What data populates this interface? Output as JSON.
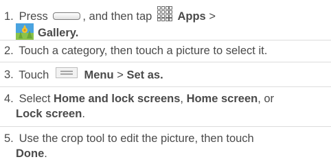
{
  "steps": [
    {
      "number": "1.",
      "press": "Press",
      "after_home": ", and then tap",
      "apps": "Apps",
      "gt": ">",
      "gallery": "Gallery",
      "period": "."
    },
    {
      "number": "2.",
      "text": "Touch a category, then touch a picture to select it."
    },
    {
      "number": "3.",
      "touch": "Touch",
      "menu": "Menu",
      "gt": ">",
      "set_as": "Set as",
      "period": "."
    },
    {
      "number": "4.",
      "select": "Select",
      "home_lock": "Home and lock screens",
      "comma1": ",",
      "home_screen": "Home screen",
      "comma_or": ", or",
      "lock_screen": "Lock screen",
      "period": "."
    },
    {
      "number": "5.",
      "text": "Use the crop tool to edit the picture, then touch",
      "done": "Done",
      "period": "."
    }
  ],
  "icons": {
    "home_key": "home-key-icon",
    "apps": "apps-grid-icon",
    "gallery": "gallery-icon",
    "menu": "menu-icon"
  },
  "colors": {
    "text": "#4a4a4a",
    "gallery_sky": "#4aa3df",
    "gallery_grass": "#8bc34a",
    "gallery_flower": "#f4c430",
    "separator": "#dcdcdc"
  }
}
